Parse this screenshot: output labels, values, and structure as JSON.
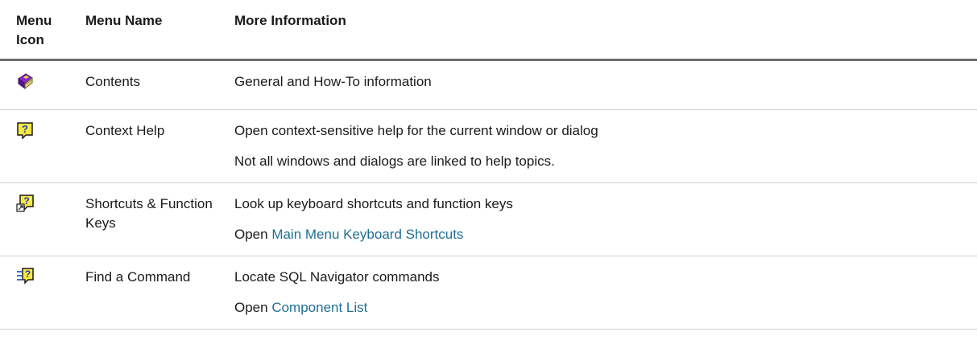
{
  "header": {
    "icon": "Menu Icon",
    "name": "Menu Name",
    "info": "More Information"
  },
  "rows": [
    {
      "icon": "book-icon",
      "name": "Contents",
      "info_lines": [
        "General and How-To information"
      ]
    },
    {
      "icon": "context-help-icon",
      "name": "Context Help",
      "info_lines": [
        "Open context-sensitive help for the current window or dialog",
        "Not all windows and dialogs are linked to help topics."
      ]
    },
    {
      "icon": "shortcuts-help-icon",
      "name": "Shortcuts & Function Keys",
      "info_lines": [
        "Look up keyboard shortcuts and function keys"
      ],
      "open_prefix": "Open ",
      "link": "Main Menu Keyboard Shortcuts"
    },
    {
      "icon": "find-command-icon",
      "name": "Find a Command",
      "info_lines": [
        "Locate SQL Navigator commands"
      ],
      "open_prefix": "Open ",
      "link": "Component List"
    }
  ],
  "colors": {
    "link": "#1f6f93",
    "header_rule": "#6d6d6d",
    "row_rule": "#cfcfcf"
  }
}
